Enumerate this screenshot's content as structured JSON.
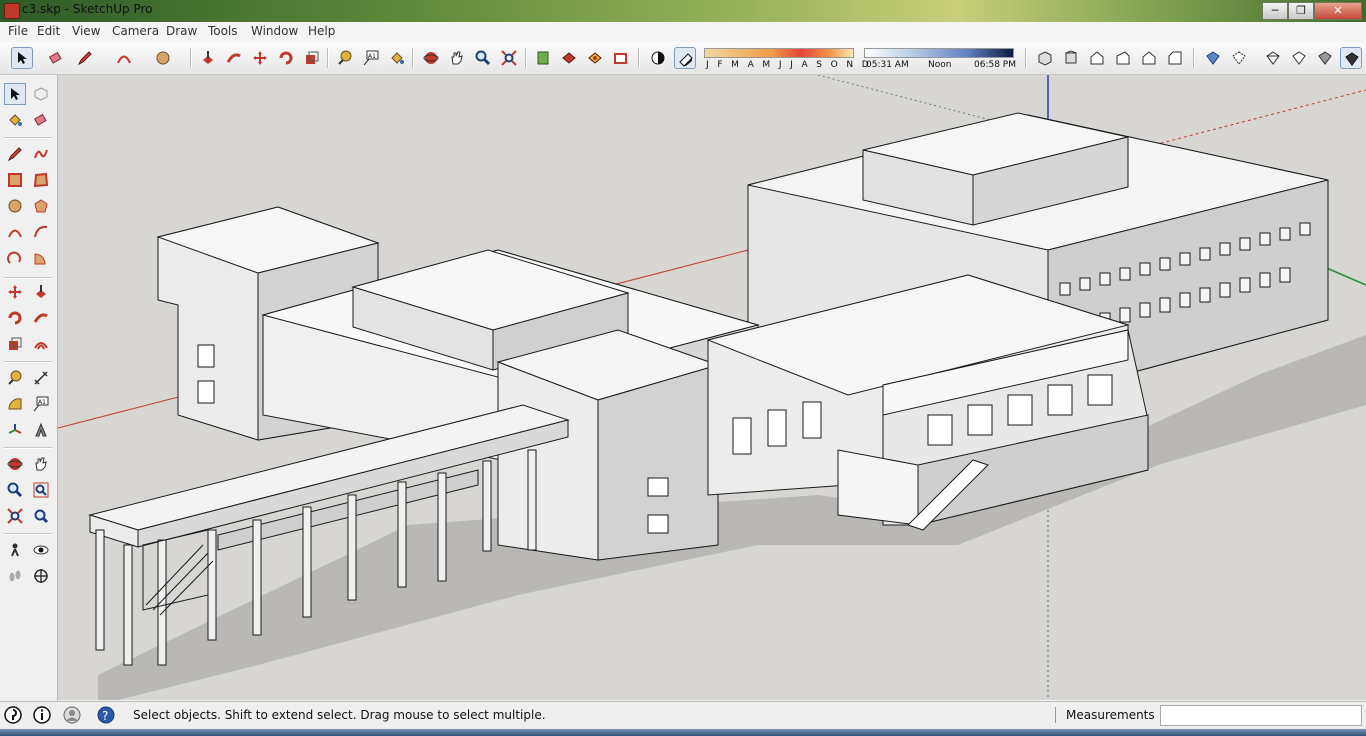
{
  "window": {
    "title": "c3.skp - SketchUp Pro",
    "minimize": "─",
    "maximize": "❐",
    "close": "✕"
  },
  "menu": [
    "File",
    "Edit",
    "View",
    "Camera",
    "Draw",
    "Tools",
    "Window",
    "Help"
  ],
  "toolbar": {
    "shadow_months": "J F M A M J J A S O N D",
    "time_start": "05:31 AM",
    "time_mid": "Noon",
    "time_end": "06:58 PM"
  },
  "status": {
    "message": "Select objects. Shift to extend select. Drag mouse to select multiple.",
    "measurements_label": "Measurements",
    "measurements_value": ""
  },
  "colors": {
    "viewport_bg": "#d7d6d3",
    "red_axis": "#c23b2c",
    "green_axis": "#2f8a3a",
    "blue_axis": "#2244aa",
    "model_face": "#f3f3f3",
    "model_side": "#c9c9c9",
    "model_edge": "#1a1a1a"
  },
  "icons": {
    "select": "arrow-cursor-icon",
    "eraser": "eraser-icon",
    "pencil": "pencil-icon",
    "orbit": "orbit-icon",
    "zoom": "magnifier-icon",
    "help": "question-icon"
  }
}
